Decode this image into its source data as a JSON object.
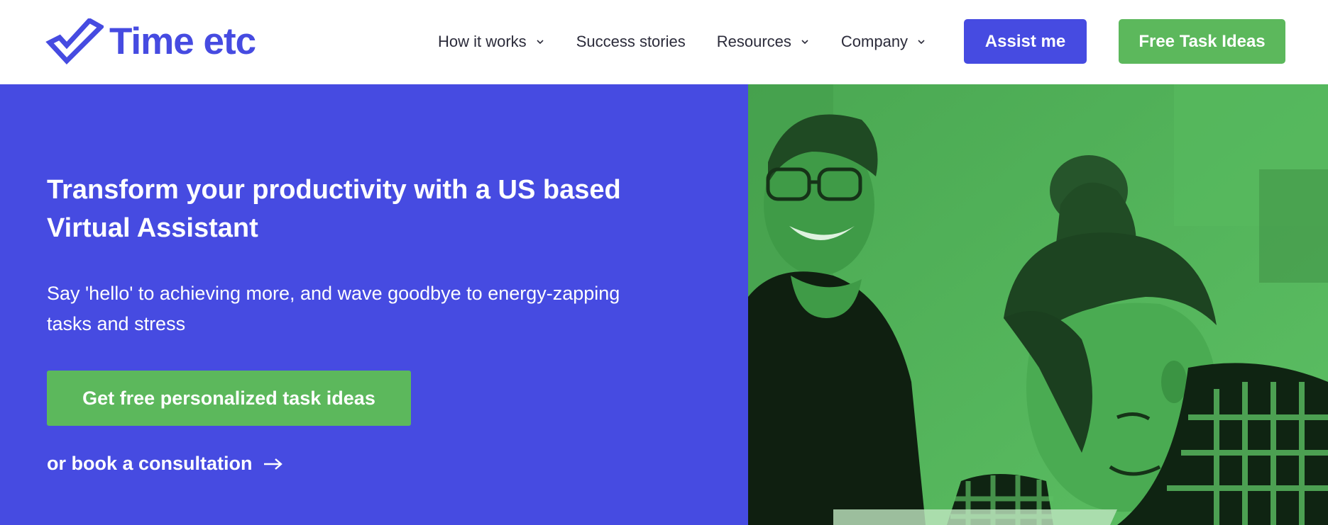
{
  "brand": {
    "name": "Time etc",
    "color": "#464be1"
  },
  "nav": {
    "items": [
      {
        "label": "How it works",
        "dropdown": true
      },
      {
        "label": "Success stories",
        "dropdown": false
      },
      {
        "label": "Resources",
        "dropdown": true
      },
      {
        "label": "Company",
        "dropdown": true
      }
    ],
    "assist_label": "Assist me",
    "free_ideas_label": "Free Task Ideas"
  },
  "hero": {
    "title": "Transform your productivity with a US based Virtual Assistant",
    "subtitle": "Say 'hello' to achieving more, and wave goodbye to energy-zapping tasks and stress",
    "cta_label": "Get free personalized task ideas",
    "consult_label": "or book a consultation"
  },
  "colors": {
    "primary": "#464be1",
    "accent_green": "#5cb85c",
    "photo_tint": "#4fae56",
    "nav_text": "#2b2b3a"
  },
  "icons": {
    "logo": "checkmark-logo-icon",
    "dropdown": "chevron-down-icon",
    "link_arrow": "arrow-right-icon"
  }
}
